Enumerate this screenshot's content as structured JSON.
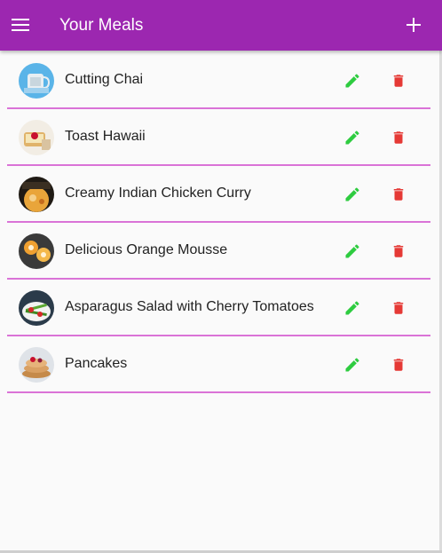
{
  "appbar": {
    "title": "Your Meals",
    "background": "#9c27b0",
    "menu_icon": "menu-icon",
    "add_icon": "add-icon"
  },
  "meals": [
    {
      "name": "Cutting Chai"
    },
    {
      "name": "Toast Hawaii"
    },
    {
      "name": "Creamy Indian Chicken Curry"
    },
    {
      "name": "Delicious Orange Mousse"
    },
    {
      "name": "Asparagus Salad with Cherry Tomatoes"
    },
    {
      "name": "Pancakes"
    }
  ],
  "actions": {
    "edit_icon": "pencil-icon",
    "edit_color": "#2ecc40",
    "delete_icon": "trash-icon",
    "delete_color": "#e53935"
  },
  "divider_color": "#da73d7"
}
